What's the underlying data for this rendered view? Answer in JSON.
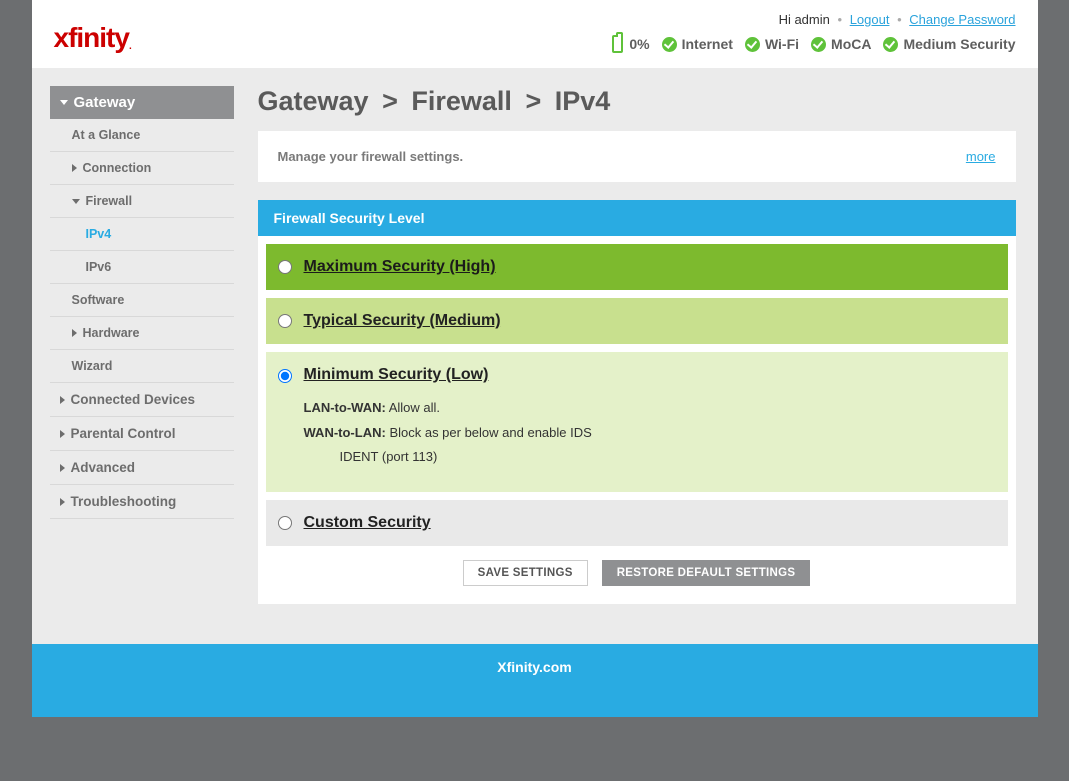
{
  "brand": "xfinity",
  "brand_trail": ".",
  "header": {
    "greeting_prefix": "Hi ",
    "username": "admin",
    "logout": "Logout",
    "change_password": "Change Password"
  },
  "status": {
    "battery_pct": "0%",
    "items": [
      "Internet",
      "Wi-Fi",
      "MoCA",
      "Medium Security"
    ]
  },
  "sidebar": {
    "top": "Gateway",
    "at_a_glance": "At a Glance",
    "connection": "Connection",
    "firewall": "Firewall",
    "ipv4": "IPv4",
    "ipv6": "IPv6",
    "software": "Software",
    "hardware": "Hardware",
    "wizard": "Wizard",
    "connected_devices": "Connected Devices",
    "parental_control": "Parental Control",
    "advanced": "Advanced",
    "troubleshooting": "Troubleshooting"
  },
  "breadcrumb": {
    "a": "Gateway",
    "b": "Firewall",
    "c": "IPv4",
    "sep": ">"
  },
  "intro": {
    "text": "Manage your firewall settings.",
    "more": "more"
  },
  "panel": {
    "title": "Firewall Security Level",
    "high": "Maximum Security (High)",
    "medium": "Typical Security (Medium)",
    "low": {
      "label": "Minimum Security (Low)",
      "lan_label": "LAN-to-WAN:",
      "lan_value": "Allow all.",
      "wan_label": "WAN-to-LAN:",
      "wan_value": "Block as per below and enable IDS",
      "ident": "IDENT (port 113)"
    },
    "custom": "Custom Security"
  },
  "buttons": {
    "save": "SAVE SETTINGS",
    "restore": "RESTORE DEFAULT SETTINGS"
  },
  "footer": {
    "link": "Xfinity.com"
  }
}
